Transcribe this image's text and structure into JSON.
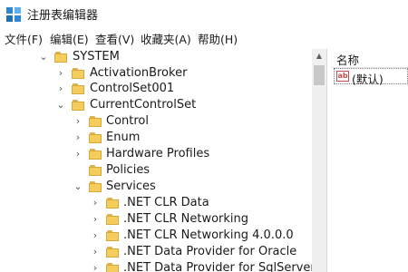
{
  "window": {
    "title": "注册表编辑器",
    "icon": "regedit-icon"
  },
  "menu": [
    {
      "label": "文件(F)"
    },
    {
      "label": "编辑(E)"
    },
    {
      "label": "查看(V)"
    },
    {
      "label": "收藏夹(A)"
    },
    {
      "label": "帮助(H)"
    }
  ],
  "tree": {
    "nodes": [
      {
        "label": "SYSTEM",
        "state": "expanded"
      },
      {
        "label": "ActivationBroker",
        "state": "collapsed"
      },
      {
        "label": "ControlSet001",
        "state": "collapsed"
      },
      {
        "label": "CurrentControlSet",
        "state": "expanded"
      },
      {
        "label": "Control",
        "state": "collapsed"
      },
      {
        "label": "Enum",
        "state": "collapsed"
      },
      {
        "label": "Hardware Profiles",
        "state": "collapsed"
      },
      {
        "label": "Policies",
        "state": "leaf"
      },
      {
        "label": "Services",
        "state": "expanded"
      },
      {
        "label": ".NET CLR Data",
        "state": "collapsed"
      },
      {
        "label": ".NET CLR Networking",
        "state": "collapsed"
      },
      {
        "label": ".NET CLR Networking 4.0.0.0",
        "state": "collapsed"
      },
      {
        "label": ".NET Data Provider for Oracle",
        "state": "collapsed"
      },
      {
        "label": ".NET Data Provider for SqlServer",
        "state": "collapsed"
      }
    ]
  },
  "list": {
    "column_name": "名称",
    "rows": [
      {
        "icon": "string-value-icon",
        "icon_text": "ab",
        "name": "(默认)"
      }
    ]
  },
  "colors": {
    "folder": "#f5cd5c",
    "string_icon": "#c0504d"
  }
}
